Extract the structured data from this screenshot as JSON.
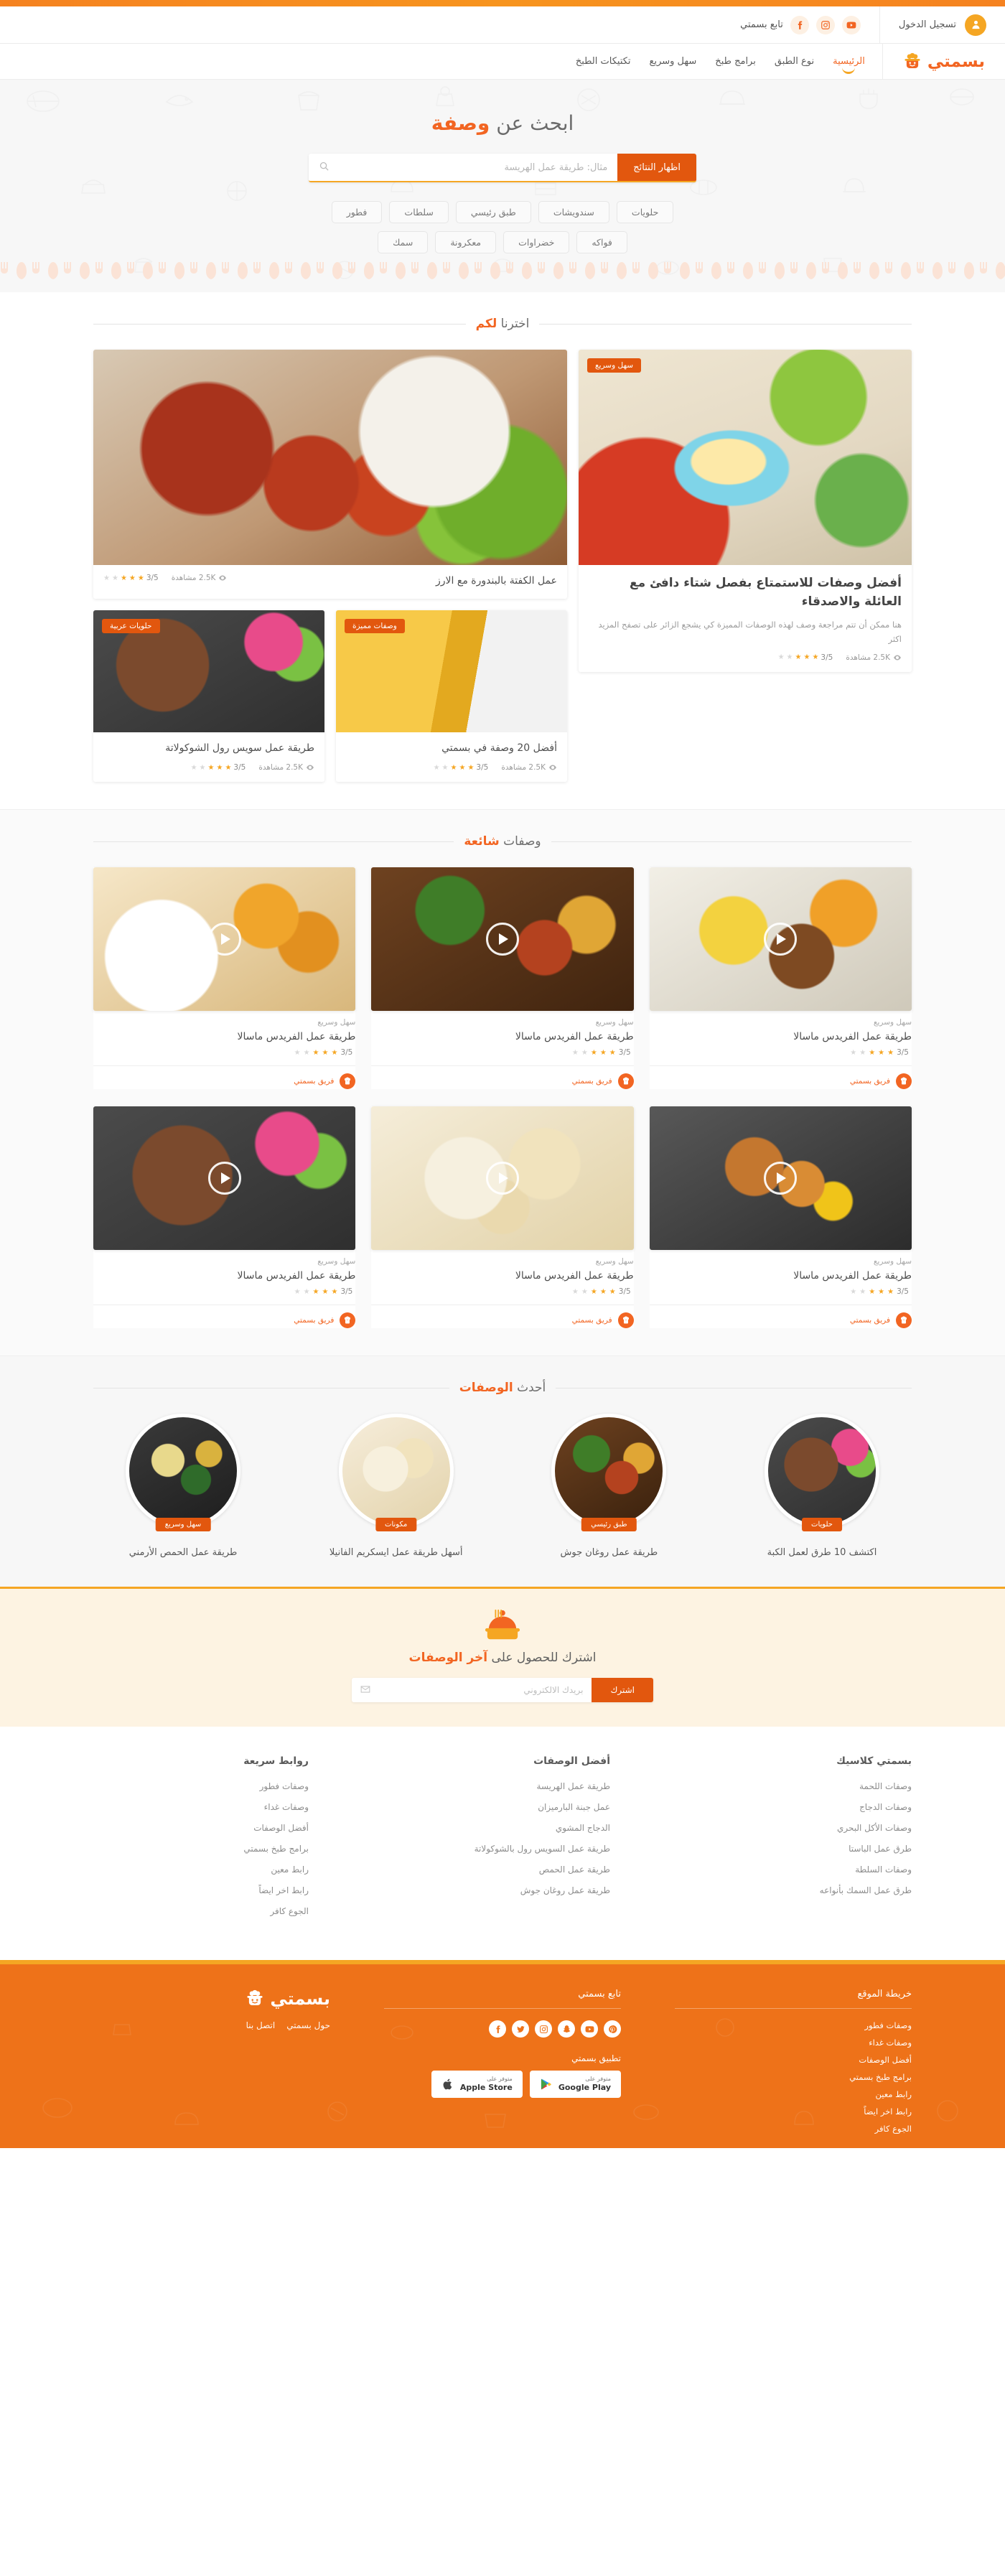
{
  "brand": {
    "name": "بسمتي",
    "logo_icon": "chef-pot-icon"
  },
  "utilbar": {
    "login_label": "تسجيل الدخول",
    "login_icon": "user-icon",
    "follow_label": "تابع بسمتي",
    "socials": [
      {
        "name": "facebook-icon",
        "label": "Facebook"
      },
      {
        "name": "instagram-icon",
        "label": "Instagram"
      },
      {
        "name": "youtube-icon",
        "label": "YouTube"
      }
    ]
  },
  "nav": {
    "items": [
      {
        "label": "الرئيسية",
        "active": true
      },
      {
        "label": "نوع الطبق",
        "active": false
      },
      {
        "label": "برامج طبخ",
        "active": false
      },
      {
        "label": "سهل وسريع",
        "active": false
      },
      {
        "label": "تكتيكات الطبخ",
        "active": false
      }
    ]
  },
  "hero": {
    "title_plain": "ابحث عن ",
    "title_accent": "وصفة",
    "search_placeholder": "مثال: طريقة عمل الهريسة",
    "search_value": "",
    "search_icon": "search-icon",
    "search_button": "اظهار النتائج",
    "tags_row1": [
      "حلويات",
      "سندويشات",
      "طبق رئيسي",
      "سلطات",
      "فطور"
    ],
    "tags_row2": [
      "فواكه",
      "خضراوات",
      "معكرونة",
      "سمك"
    ]
  },
  "chosen": {
    "heading_plain": "اخترنا ",
    "heading_accent": "لكم",
    "main_card": {
      "title": "عمل الكفتة بالبندورة مع الارز",
      "rating": "3/5",
      "stars": 3,
      "views": "2.5K مشاهدة",
      "view_icon": "eye-icon"
    },
    "side_card": {
      "badge": "سهل وسريع",
      "title": "أفضل وصفات للاستمتاع بفصل شتاء دافئ مع العائلة والاصدقاء",
      "desc": "هنا ممكن أن تتم مراجعة وصف لهذه الوصفات المميزة كي يشجع الزائر على تصفح المزيد اكثر",
      "rating": "3/5",
      "stars": 3,
      "views": "2.5K مشاهدة",
      "view_icon": "eye-icon"
    },
    "small_cards": [
      {
        "badge": "وصفات مميزة",
        "title": "أفضل 20 وصفة في بسمتي",
        "rating": "3/5",
        "stars": 3,
        "views": "2.5K مشاهدة",
        "view_icon": "eye-icon"
      },
      {
        "badge": "حلويات عربية",
        "title": "طريقة عمل سويس رول الشوكولاتة",
        "rating": "3/5",
        "stars": 3,
        "views": "2.5K مشاهدة",
        "view_icon": "eye-icon"
      }
    ]
  },
  "popular": {
    "heading_plain": "وصفات ",
    "heading_accent": "شائعة",
    "cards": [
      {
        "tag": "سهل وسريع",
        "title": "طريقة عمل الفريدس ماسالا",
        "rating": "3/5",
        "stars": 3,
        "chef": "فريق بسمتي",
        "chef_icon": "chef-hat-icon",
        "play_icon": "play-icon"
      },
      {
        "tag": "سهل وسريع",
        "title": "طريقة عمل الفريدس ماسالا",
        "rating": "3/5",
        "stars": 3,
        "chef": "فريق بسمتي",
        "chef_icon": "chef-hat-icon",
        "play_icon": "play-icon"
      },
      {
        "tag": "سهل وسريع",
        "title": "طريقة عمل الفريدس ماسالا",
        "rating": "3/5",
        "stars": 3,
        "chef": "فريق بسمتي",
        "chef_icon": "chef-hat-icon",
        "play_icon": "play-icon"
      },
      {
        "tag": "سهل وسريع",
        "title": "طريقة عمل الفريدس ماسالا",
        "rating": "3/5",
        "stars": 3,
        "chef": "فريق بسمتي",
        "chef_icon": "chef-hat-icon",
        "play_icon": "play-icon"
      },
      {
        "tag": "سهل وسريع",
        "title": "طريقة عمل الفريدس ماسالا",
        "rating": "3/5",
        "stars": 3,
        "chef": "فريق بسمتي",
        "chef_icon": "chef-hat-icon",
        "play_icon": "play-icon"
      },
      {
        "tag": "سهل وسريع",
        "title": "طريقة عمل الفريدس ماسالا",
        "rating": "3/5",
        "stars": 3,
        "chef": "فريق بسمتي",
        "chef_icon": "chef-hat-icon",
        "play_icon": "play-icon"
      }
    ]
  },
  "latest": {
    "heading_plain": "أحدث ",
    "heading_accent": "الوصفات",
    "items": [
      {
        "badge": "حلويات",
        "title": "اكتشف 10 طرق لعمل الكبة"
      },
      {
        "badge": "طبق رئيسي",
        "title": "طريقة عمل روغان جوش"
      },
      {
        "badge": "مكونات",
        "title": "أسهل طريقة عمل ايسكريم الفانيلا"
      },
      {
        "badge": "سهل وسريع",
        "title": "طريقة عمل الحمص الأرمني"
      }
    ]
  },
  "newsletter": {
    "icon": "chef-bell-icon",
    "title_plain": "اشترك للحصول على ",
    "title_accent": "آخر الوصفات",
    "placeholder": "بريدك الالكتروني",
    "value": "",
    "mail_icon": "envelope-icon",
    "button": "اشترك"
  },
  "linkcols": [
    {
      "heading": "روابط سريعة",
      "links": [
        "وصفات فطور",
        "وصفات غداء",
        "أفضل الوصفات",
        "برامج طبخ بسمتي",
        "رابط معين",
        "رابط اخر ايضاً",
        "الجوع كافر"
      ]
    },
    {
      "heading": "أفضل الوصفات",
      "links": [
        "طريقة عمل الهريسة",
        "عمل جبنة البارميزان",
        "الدجاج المشوي",
        "طريقة عمل السويس رول بالشوكولاتة",
        "طريقة عمل الحمص",
        "طريقة عمل روغان جوش"
      ]
    },
    {
      "heading": "بسمتي كلاسيك",
      "links": [
        "وصفات اللحمة",
        "وصفات الدجاج",
        "وصفات الأكل البحري",
        "طرق عمل الباستا",
        "وصفات السلطة",
        "طرق عمل السمك بأنواعه"
      ]
    }
  ],
  "footer": {
    "brand": "بسمتي",
    "brand_logo": "chef-pot-icon",
    "brand_links": [
      "حول بسمتي",
      "اتصل بنا"
    ],
    "follow_heading": "تابع بسمتي",
    "socials": [
      {
        "name": "facebook-icon"
      },
      {
        "name": "twitter-icon"
      },
      {
        "name": "instagram-icon"
      },
      {
        "name": "snapchat-icon"
      },
      {
        "name": "youtube-icon"
      },
      {
        "name": "pinterest-icon"
      }
    ],
    "app_heading": "تطبيق بسمتي",
    "stores": [
      {
        "small": "متوفر على",
        "big": "Google Play",
        "icon": "google-play-icon"
      },
      {
        "small": "متوفر على",
        "big": "Apple Store",
        "icon": "apple-icon"
      }
    ],
    "sitemap_heading": "خريطة الموقع",
    "sitemap_links": [
      "وصفات فطور",
      "وصفات غداء",
      "أفضل الوصفات",
      "برامج طبخ بسمتي",
      "رابط معين",
      "رابط اخر ايضاً",
      "الجوع كافر"
    ]
  },
  "colors": {
    "brand_orange": "#f26522",
    "amber": "#f5a623",
    "deep_orange": "#e2570e",
    "footer_orange": "#ee7219"
  }
}
